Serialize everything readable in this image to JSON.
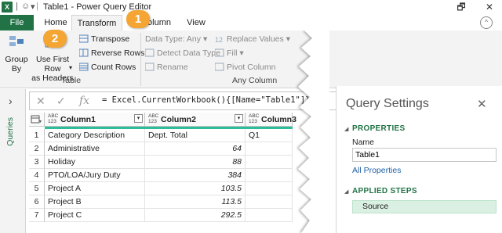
{
  "window": {
    "title": "Table1 - Power Query Editor",
    "controls": {
      "restore": "🗗",
      "close": "✕"
    }
  },
  "tabs": [
    {
      "label": "File"
    },
    {
      "label": "Home"
    },
    {
      "label": "Transform"
    },
    {
      "label": "olumn"
    },
    {
      "label": "View"
    }
  ],
  "ribbon": {
    "group_by": "Group\nBy",
    "use_first_row": "Use First Row\nas Headers",
    "transpose": "Transpose",
    "reverse_rows": "Reverse Rows",
    "count_rows": "Count Rows",
    "group_table_label": "Table",
    "data_type": "Data Type: Any",
    "detect_data_type": "Detect Data Type",
    "rename": "Rename",
    "replace_values": "Replace Values",
    "fill": "Fill",
    "pivot_column": "Pivot Column",
    "group_anycol_label": "Any Column"
  },
  "callouts": {
    "one": "1",
    "two": "2"
  },
  "queries_pane": {
    "label": "Queries"
  },
  "formula_bar": {
    "formula": "= Excel.CurrentWorkbook(){[Name=\"Table1\"]}[Co"
  },
  "grid": {
    "columns": [
      {
        "type": "ABC\n123",
        "name": "Column1"
      },
      {
        "type": "ABC\n123",
        "name": "Column2"
      },
      {
        "type": "ABC\n123",
        "name": "Column3"
      }
    ],
    "rows": [
      {
        "n": "1",
        "c1": "Category Description",
        "c2": "Dept. Total",
        "c3": "Q1"
      },
      {
        "n": "2",
        "c1": "Administrative",
        "c2": "64",
        "c3": ""
      },
      {
        "n": "3",
        "c1": "Holiday",
        "c2": "88",
        "c3": ""
      },
      {
        "n": "4",
        "c1": "PTO/LOA/Jury Duty",
        "c2": "384",
        "c3": ""
      },
      {
        "n": "5",
        "c1": "Project A",
        "c2": "103.5",
        "c3": ""
      },
      {
        "n": "6",
        "c1": "Project B",
        "c2": "113.5",
        "c3": ""
      },
      {
        "n": "7",
        "c1": "Project C",
        "c2": "292.5",
        "c3": ""
      }
    ]
  },
  "query_settings": {
    "title": "Query Settings",
    "properties_header": "PROPERTIES",
    "name_label": "Name",
    "name_value": "Table1",
    "all_properties": "All Properties",
    "applied_steps_header": "APPLIED STEPS",
    "steps": [
      {
        "label": "Source"
      }
    ]
  },
  "colors": {
    "excel_green": "#217346",
    "callout_orange": "#f4a533",
    "step_selected": "#d9f0e2",
    "column_quality_bar": "#2ebd9b"
  }
}
